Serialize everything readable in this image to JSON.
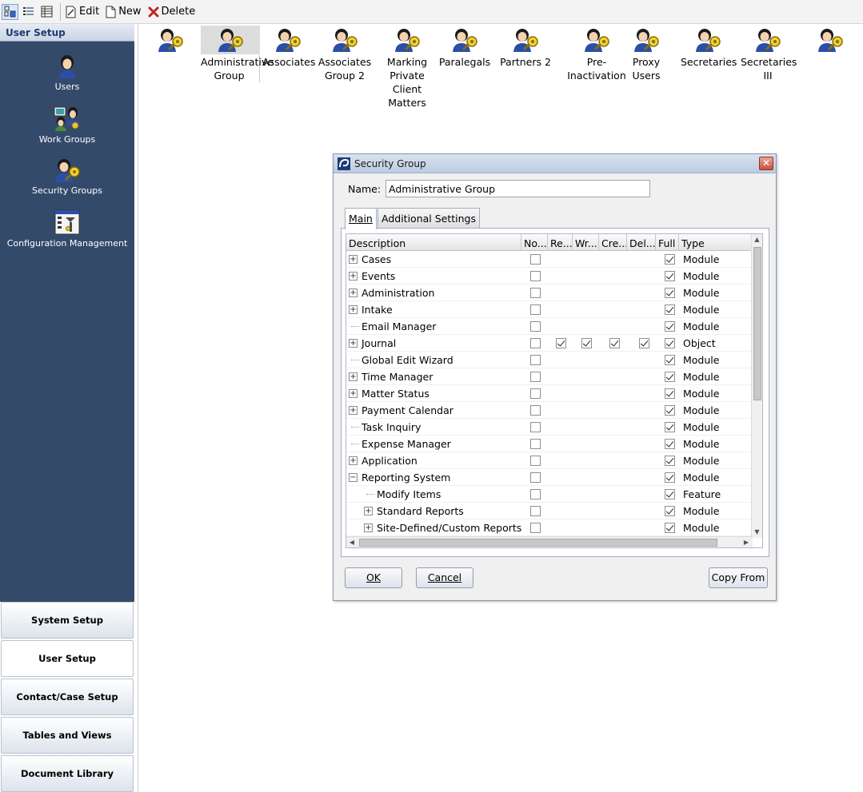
{
  "toolbar": {
    "edit_label": "Edit",
    "new_label": "New",
    "delete_label": "Delete"
  },
  "sidebar": {
    "header": "User Setup",
    "items": [
      {
        "label": "Users",
        "icon": "user-icon"
      },
      {
        "label": "Work Groups",
        "icon": "work-groups-icon"
      },
      {
        "label": "Security Groups",
        "icon": "security-group-icon"
      },
      {
        "label": "Configuration Management",
        "icon": "configuration-icon"
      }
    ],
    "sections": [
      {
        "label": "System Setup"
      },
      {
        "label": "User Setup"
      },
      {
        "label": "Contact/Case Setup"
      },
      {
        "label": "Tables and Views"
      },
      {
        "label": "Document Library"
      }
    ]
  },
  "groups": [
    {
      "label": ""
    },
    {
      "label": "Administrative Group",
      "selected": true
    },
    {
      "label": "Associates"
    },
    {
      "label": "Associates Group 2"
    },
    {
      "label": "Marking Private Client Matters"
    },
    {
      "label": "Paralegals"
    },
    {
      "label": "Partners 2"
    },
    {
      "label": "Pre-Inactivation"
    },
    {
      "label": "Proxy Users"
    },
    {
      "label": "Secretaries"
    },
    {
      "label": "Secretaries III"
    },
    {
      "label": ""
    }
  ],
  "dialog": {
    "title": "Security Group",
    "close": "✕",
    "name_label": "Name:",
    "name_value": "Administrative Group",
    "tabs": [
      {
        "label": "Main",
        "active": true
      },
      {
        "label": "Additional Settings",
        "active": false
      }
    ],
    "columns": [
      "Description",
      "No...",
      "Re...",
      "Wr...",
      "Cre...",
      "Del...",
      "Full",
      "Type"
    ],
    "rows": [
      {
        "label": "Cases",
        "expander": "+",
        "level": 0,
        "none": false,
        "read": null,
        "write": null,
        "create": null,
        "delete": null,
        "full": true,
        "type": "Module"
      },
      {
        "label": "Events",
        "expander": "+",
        "level": 0,
        "none": false,
        "read": null,
        "write": null,
        "create": null,
        "delete": null,
        "full": true,
        "type": "Module"
      },
      {
        "label": "Administration",
        "expander": "+",
        "level": 0,
        "none": false,
        "read": null,
        "write": null,
        "create": null,
        "delete": null,
        "full": true,
        "type": "Module"
      },
      {
        "label": "Intake",
        "expander": "+",
        "level": 0,
        "none": false,
        "read": null,
        "write": null,
        "create": null,
        "delete": null,
        "full": true,
        "type": "Module"
      },
      {
        "label": "Email Manager",
        "expander": "",
        "level": 0,
        "none": false,
        "read": null,
        "write": null,
        "create": null,
        "delete": null,
        "full": true,
        "type": "Module"
      },
      {
        "label": "Journal",
        "expander": "+",
        "level": 0,
        "none": false,
        "read": true,
        "write": true,
        "create": true,
        "delete": true,
        "full": true,
        "type": "Object"
      },
      {
        "label": "Global Edit Wizard",
        "expander": "",
        "level": 0,
        "none": false,
        "read": null,
        "write": null,
        "create": null,
        "delete": null,
        "full": true,
        "type": "Module"
      },
      {
        "label": "Time Manager",
        "expander": "+",
        "level": 0,
        "none": false,
        "read": null,
        "write": null,
        "create": null,
        "delete": null,
        "full": true,
        "type": "Module"
      },
      {
        "label": "Matter Status",
        "expander": "+",
        "level": 0,
        "none": false,
        "read": null,
        "write": null,
        "create": null,
        "delete": null,
        "full": true,
        "type": "Module"
      },
      {
        "label": "Payment Calendar",
        "expander": "+",
        "level": 0,
        "none": false,
        "read": null,
        "write": null,
        "create": null,
        "delete": null,
        "full": true,
        "type": "Module"
      },
      {
        "label": "Task Inquiry",
        "expander": "",
        "level": 0,
        "none": false,
        "read": null,
        "write": null,
        "create": null,
        "delete": null,
        "full": true,
        "type": "Module"
      },
      {
        "label": "Expense Manager",
        "expander": "",
        "level": 0,
        "none": false,
        "read": null,
        "write": null,
        "create": null,
        "delete": null,
        "full": true,
        "type": "Module"
      },
      {
        "label": "Application",
        "expander": "+",
        "level": 0,
        "none": false,
        "read": null,
        "write": null,
        "create": null,
        "delete": null,
        "full": true,
        "type": "Module"
      },
      {
        "label": "Reporting System",
        "expander": "−",
        "level": 0,
        "none": false,
        "read": null,
        "write": null,
        "create": null,
        "delete": null,
        "full": true,
        "type": "Module"
      },
      {
        "label": "Modify Items",
        "expander": "",
        "level": 1,
        "none": false,
        "read": null,
        "write": null,
        "create": null,
        "delete": null,
        "full": true,
        "type": "Feature"
      },
      {
        "label": "Standard Reports",
        "expander": "+",
        "level": 1,
        "none": false,
        "read": null,
        "write": null,
        "create": null,
        "delete": null,
        "full": true,
        "type": "Module"
      },
      {
        "label": "Site-Defined/Custom Reports",
        "expander": "+",
        "level": 1,
        "none": false,
        "read": null,
        "write": null,
        "create": null,
        "delete": null,
        "full": true,
        "type": "Module",
        "highlighted": true
      }
    ],
    "buttons": {
      "ok": "OK",
      "cancel": "Cancel",
      "copy_from": "Copy From"
    }
  }
}
